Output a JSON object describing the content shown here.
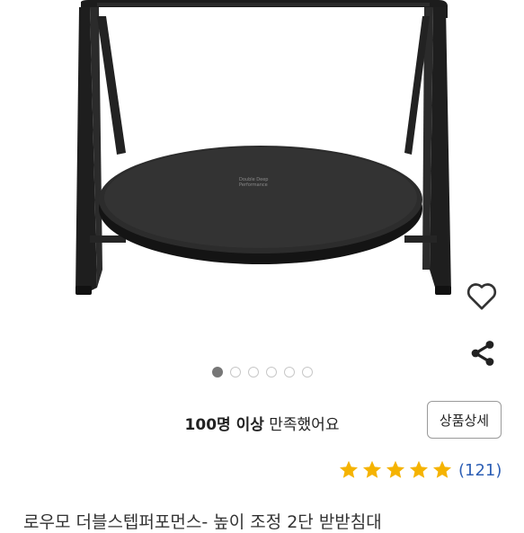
{
  "product": {
    "print_text": "Double Deep Performance",
    "title": "로우모 더블스텝퍼포먼스- 높이 조정 2단 받받침대"
  },
  "gallery": {
    "total_images": 6,
    "active_index": 0
  },
  "satisfaction": {
    "count_text": "100명 이상",
    "suffix_text": " 만족했어요"
  },
  "buttons": {
    "detail_label": "상품상세"
  },
  "rating": {
    "stars": 5,
    "count_text": "(121)"
  },
  "colors": {
    "star": "#f5b301",
    "link": "#2d5fb5",
    "dot_active": "#777777",
    "dot_inactive": "#c8c8c8"
  },
  "icons": {
    "wishlist": "heart-outline-icon",
    "share": "share-icon",
    "star": "star-icon"
  }
}
